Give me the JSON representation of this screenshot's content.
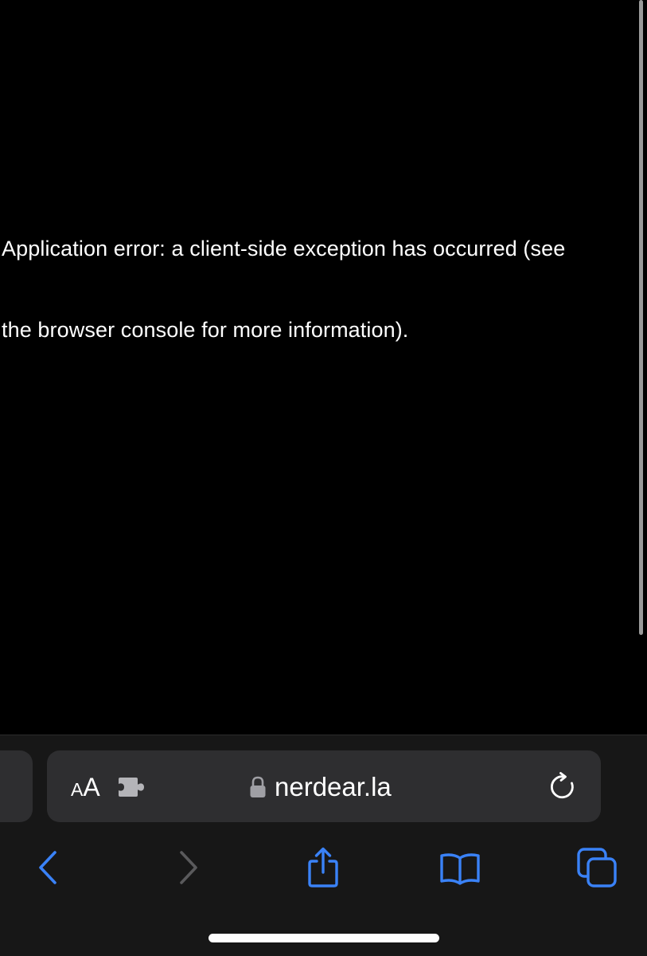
{
  "content": {
    "error_line_1": "Application error: a client-side exception has occurred (see",
    "error_line_2": "the browser console for more information)."
  },
  "address_bar": {
    "reader_small": "A",
    "reader_large": "A",
    "url": "nerdear.la",
    "icons": {
      "extension": "puzzle-piece-icon",
      "lock": "lock-icon",
      "reload": "reload-icon"
    }
  },
  "toolbar": {
    "icons": [
      "chevron-left-icon",
      "chevron-right-icon",
      "share-icon",
      "bookmarks-icon",
      "tabs-icon"
    ]
  },
  "colors": {
    "background": "#000000",
    "toolbar": "#171717",
    "address_bar": "#2e2e30",
    "accent": "#3a82f7",
    "disabled": "#5a5a5c"
  }
}
